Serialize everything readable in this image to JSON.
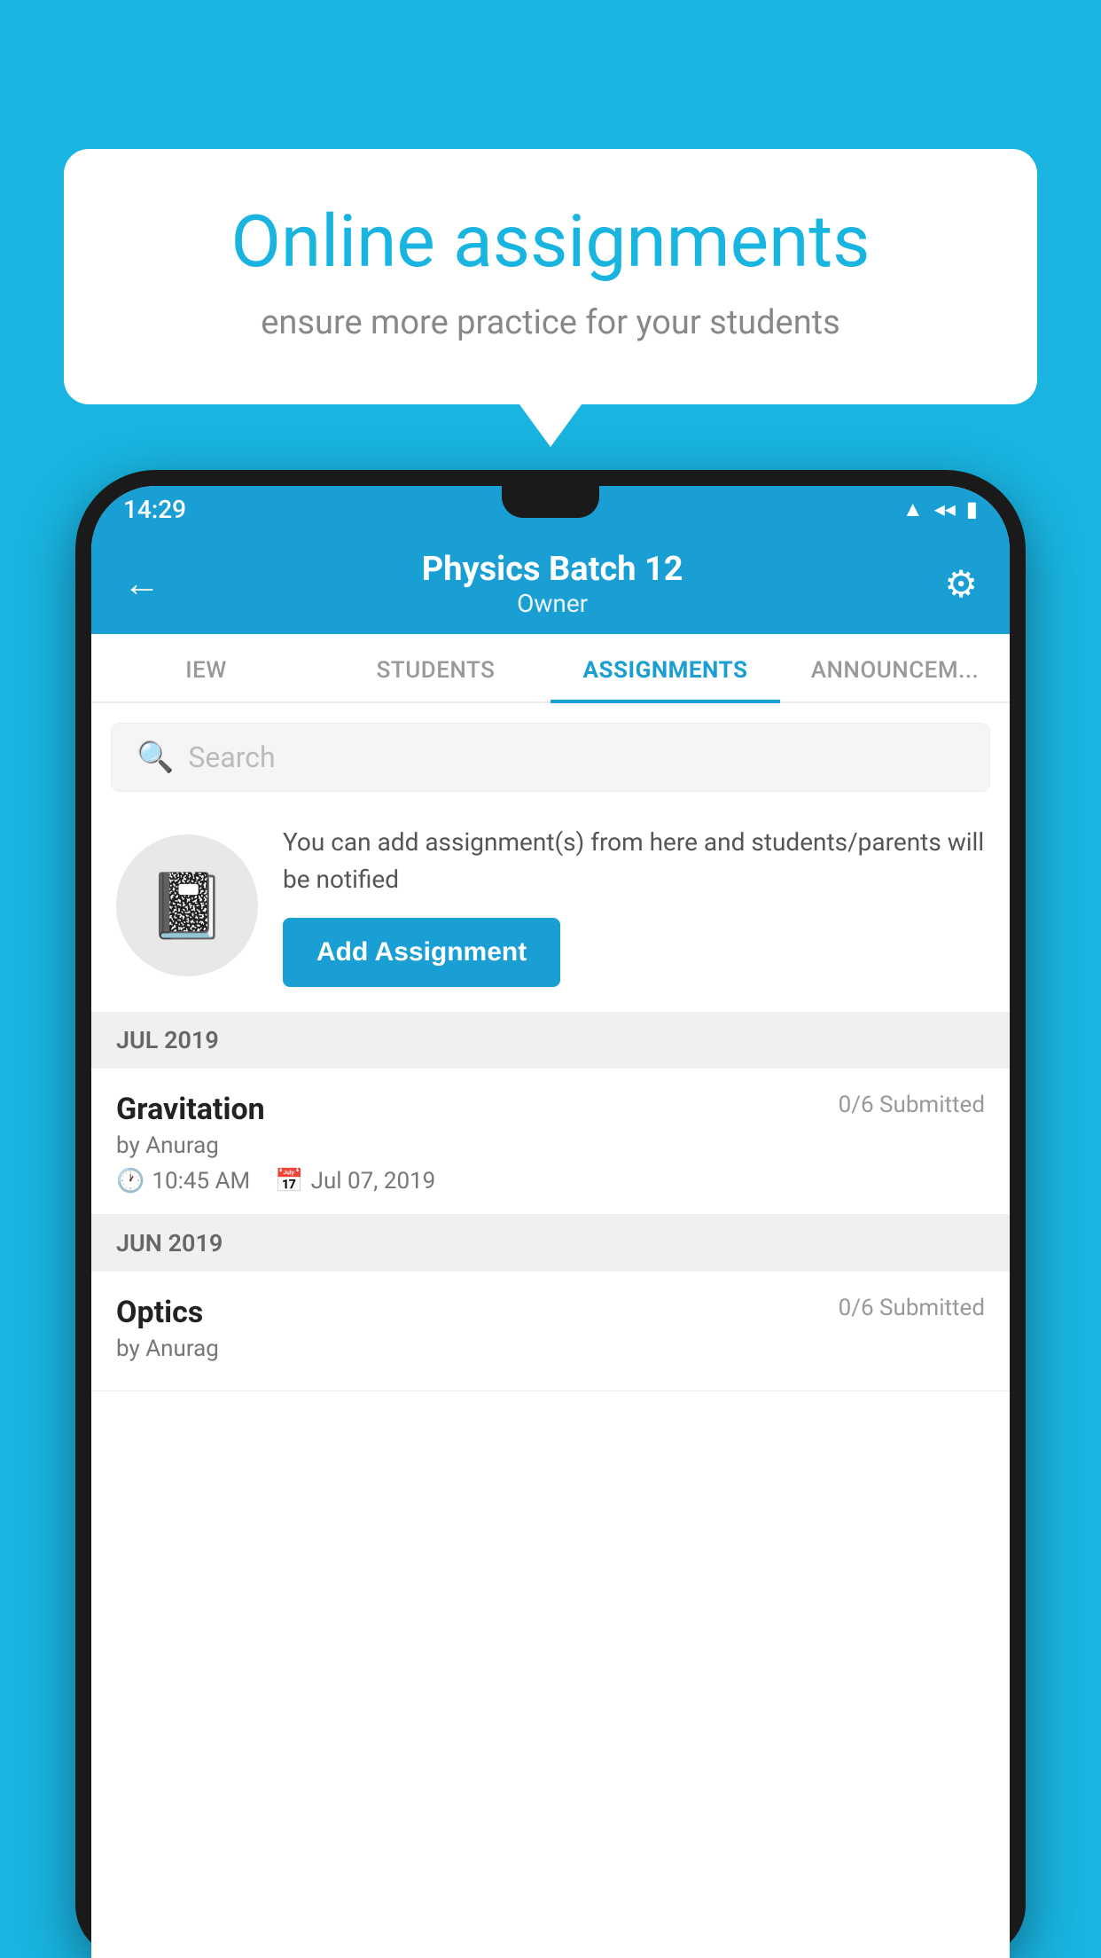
{
  "background_color": "#19b4e0",
  "speech_bubble": {
    "title": "Online assignments",
    "subtitle": "ensure more practice for your students"
  },
  "status_bar": {
    "time": "14:29",
    "icons": [
      "wifi",
      "signal",
      "battery"
    ]
  },
  "header": {
    "title": "Physics Batch 12",
    "subtitle": "Owner",
    "back_label": "←",
    "gear_label": "⚙"
  },
  "tabs": [
    {
      "label": "IEW",
      "active": false
    },
    {
      "label": "STUDENTS",
      "active": false
    },
    {
      "label": "ASSIGNMENTS",
      "active": true
    },
    {
      "label": "ANNOUNCEM...",
      "active": false
    }
  ],
  "search": {
    "placeholder": "Search"
  },
  "promo": {
    "text": "You can add assignment(s) from here and students/parents will be notified",
    "button_label": "Add Assignment"
  },
  "sections": [
    {
      "label": "JUL 2019",
      "assignments": [
        {
          "name": "Gravitation",
          "submitted": "0/6 Submitted",
          "by": "by Anurag",
          "time": "10:45 AM",
          "date": "Jul 07, 2019"
        }
      ]
    },
    {
      "label": "JUN 2019",
      "assignments": [
        {
          "name": "Optics",
          "submitted": "0/6 Submitted",
          "by": "by Anurag",
          "time": "",
          "date": ""
        }
      ]
    }
  ]
}
